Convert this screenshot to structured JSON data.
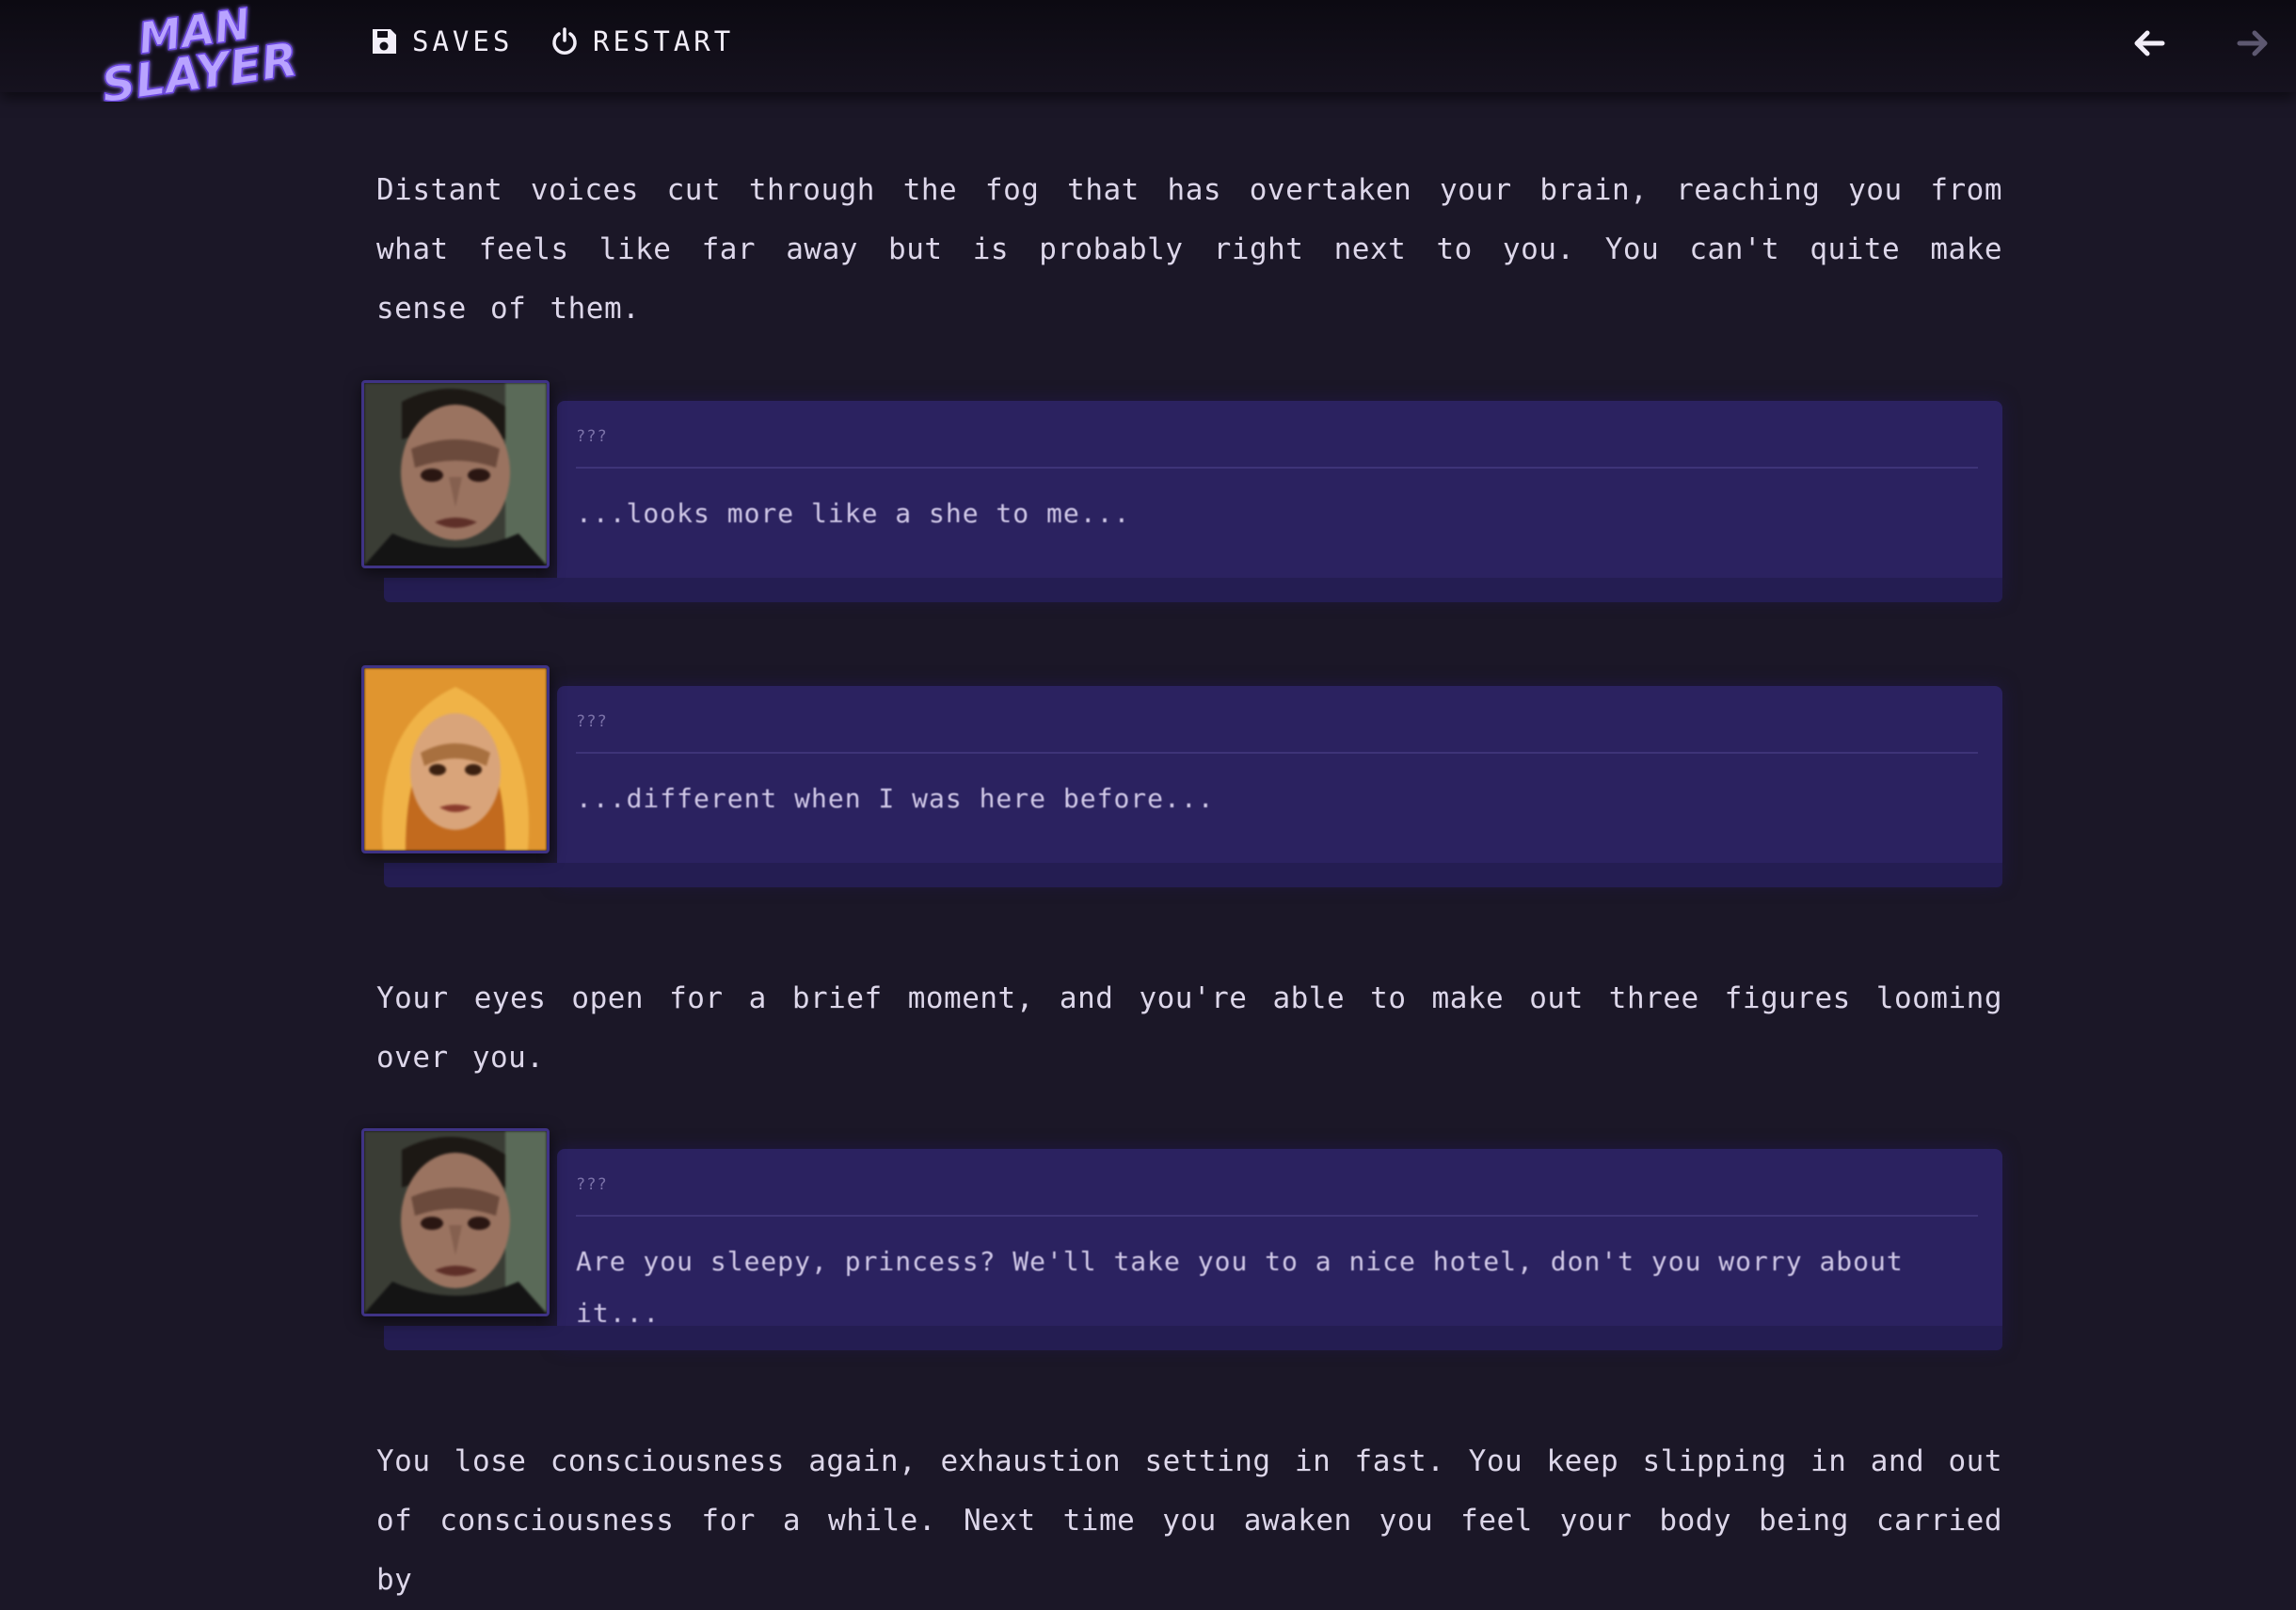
{
  "app": {
    "logo_text": [
      "MAN",
      "SLAYER"
    ],
    "logo_icon": "man-slayer-logo",
    "accent_color": "#8b5cf6"
  },
  "toolbar": {
    "saves_label": "SAVES",
    "saves_icon": "floppy-disk-icon",
    "restart_label": "RESTART",
    "restart_icon": "power-icon",
    "back_icon": "arrow-left-icon",
    "forward_icon": "arrow-right-icon"
  },
  "story": {
    "paragraphs": [
      "Distant voices cut through the fog that has overtaken your brain, reaching you from what feels like far away but is probably right next to you. You can't quite make sense of them.",
      "Your eyes open for a brief moment, and you're able to make out three figures looming over you.",
      "You lose consciousness again, exhaustion setting in fast. You keep slipping in and out of consciousness for a while. Next time you awaken you feel your body being carried by"
    ],
    "dialogues": [
      {
        "speaker": "???",
        "text": "...looks more like a she to me...",
        "portrait": "vampire-man-portrait"
      },
      {
        "speaker": "???",
        "text": "...different when I was here before...",
        "portrait": "vampire-woman-portrait"
      },
      {
        "speaker": "???",
        "text": "Are you sleepy, princess? We'll take you to a nice hotel, don't you worry about it...",
        "portrait": "vampire-man-portrait"
      }
    ]
  }
}
